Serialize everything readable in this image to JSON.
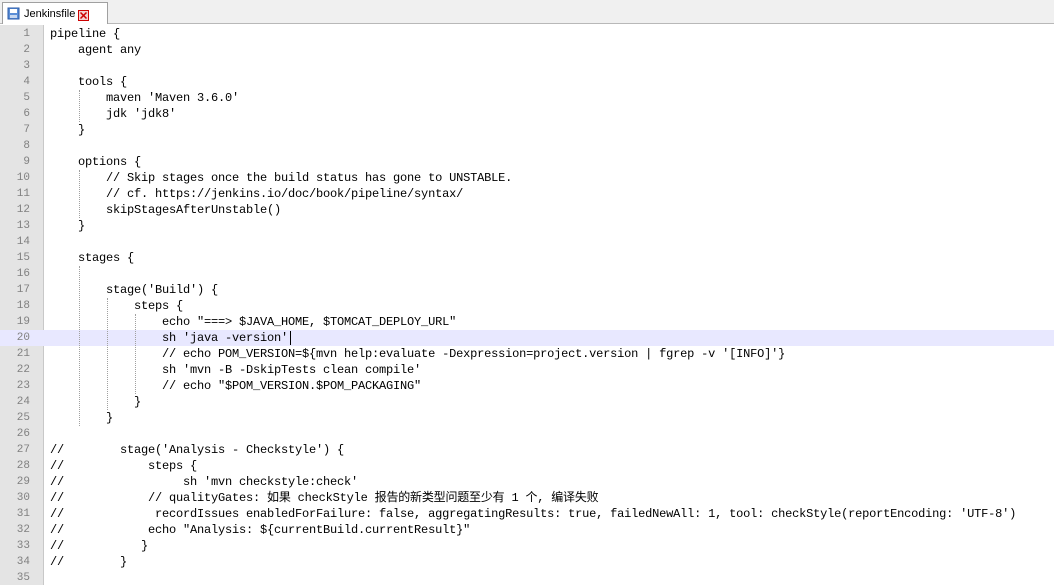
{
  "tab": {
    "title": "Jenkinsfile"
  },
  "editor": {
    "current_line": 20,
    "lines": [
      {
        "n": "1",
        "text": "pipeline {"
      },
      {
        "n": "2",
        "text": "    agent any"
      },
      {
        "n": "3",
        "text": ""
      },
      {
        "n": "4",
        "text": "    tools {"
      },
      {
        "n": "5",
        "text": "        maven 'Maven 3.6.0'"
      },
      {
        "n": "6",
        "text": "        jdk 'jdk8'"
      },
      {
        "n": "7",
        "text": "    }"
      },
      {
        "n": "8",
        "text": ""
      },
      {
        "n": "9",
        "text": "    options {"
      },
      {
        "n": "10",
        "text": "        // Skip stages once the build status has gone to UNSTABLE."
      },
      {
        "n": "11",
        "text": "        // cf. https://jenkins.io/doc/book/pipeline/syntax/"
      },
      {
        "n": "12",
        "text": "        skipStagesAfterUnstable()"
      },
      {
        "n": "13",
        "text": "    }"
      },
      {
        "n": "14",
        "text": ""
      },
      {
        "n": "15",
        "text": "    stages {"
      },
      {
        "n": "16",
        "text": ""
      },
      {
        "n": "17",
        "text": "        stage('Build') {"
      },
      {
        "n": "18",
        "text": "            steps {"
      },
      {
        "n": "19",
        "text": "                echo \"===> $JAVA_HOME, $TOMCAT_DEPLOY_URL\""
      },
      {
        "n": "20",
        "text": "                sh 'java -version'"
      },
      {
        "n": "21",
        "text": "                // echo POM_VERSION=${mvn help:evaluate -Dexpression=project.version | fgrep -v '[INFO]'}"
      },
      {
        "n": "22",
        "text": "                sh 'mvn -B -DskipTests clean compile'"
      },
      {
        "n": "23",
        "text": "                // echo \"$POM_VERSION.$POM_PACKAGING\""
      },
      {
        "n": "24",
        "text": "            }"
      },
      {
        "n": "25",
        "text": "        }"
      },
      {
        "n": "26",
        "text": ""
      },
      {
        "n": "27",
        "text": "//        stage('Analysis - Checkstyle') {"
      },
      {
        "n": "28",
        "text": "//            steps {"
      },
      {
        "n": "29",
        "text": "//                 sh 'mvn checkstyle:check'"
      },
      {
        "n": "30",
        "text": "//            // qualityGates: 如果 checkStyle 报告的新类型问题至少有 1 个, 编译失败"
      },
      {
        "n": "31",
        "text": "//             recordIssues enabledForFailure: false, aggregatingResults: true, failedNewAll: 1, tool: checkStyle(reportEncoding: 'UTF-8')"
      },
      {
        "n": "32",
        "text": "//            echo \"Analysis: ${currentBuild.currentResult}\""
      },
      {
        "n": "33",
        "text": "//           }"
      },
      {
        "n": "34",
        "text": "//        }"
      },
      {
        "n": "35",
        "text": ""
      }
    ]
  },
  "colors": {
    "gutter": "#e4e4e4",
    "current_line": "#e8e8ff",
    "line_number": "#808080",
    "close_icon": "#cc0000"
  },
  "icons": {
    "tab_file": "file-icon",
    "tab_close": "close-icon"
  }
}
